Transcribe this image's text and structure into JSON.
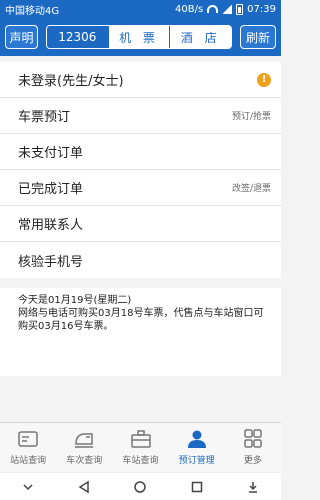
{
  "status_bar": {
    "carrier": "中国移动4G",
    "speed": "40B/s",
    "time": "07:39"
  },
  "header": {
    "left_button": "声明",
    "tabs": [
      "12306",
      "机 票",
      "酒 店"
    ],
    "right_button": "刷新"
  },
  "menu": [
    {
      "label": "未登录(先生/女士)",
      "hint": "",
      "icon": "warning-icon"
    },
    {
      "label": "车票预订",
      "hint": "预订/抢票"
    },
    {
      "label": "未支付订单",
      "hint": ""
    },
    {
      "label": "已完成订单",
      "hint": "改签/退票"
    },
    {
      "label": "常用联系人",
      "hint": ""
    },
    {
      "label": "核验手机号",
      "hint": ""
    }
  ],
  "notice": {
    "line1": "今天是01月19号(星期二)",
    "line2": "网络与电话可购买03月18号车票，代售点与车站窗口可购买03月16号车票。"
  },
  "bottom_nav": [
    {
      "label": "站站查询",
      "icon": "ticket-icon"
    },
    {
      "label": "车次查询",
      "icon": "train-icon"
    },
    {
      "label": "车站查询",
      "icon": "station-icon"
    },
    {
      "label": "预订管理",
      "icon": "user-icon",
      "active": true
    },
    {
      "label": "更多",
      "icon": "grid-icon"
    }
  ],
  "colors": {
    "primary": "#1c69c4",
    "warning": "#f1a01a"
  }
}
